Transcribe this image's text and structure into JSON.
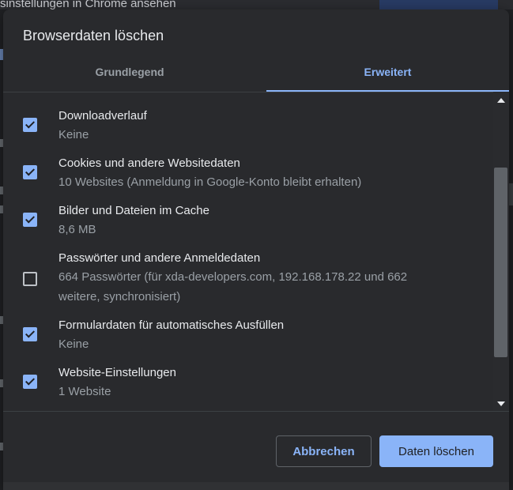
{
  "background": {
    "heading": "sinstellungen in Chrome ansehen"
  },
  "dialog": {
    "title": "Browserdaten löschen",
    "tabs": [
      {
        "label": "Grundlegend",
        "selected": false
      },
      {
        "label": "Erweitert",
        "selected": true
      }
    ],
    "items": [
      {
        "title": "Downloadverlauf",
        "description": "Keine",
        "checked": true
      },
      {
        "title": "Cookies und andere Websitedaten",
        "description": "10 Websites (Anmeldung in Google-Konto bleibt erhalten)",
        "checked": true
      },
      {
        "title": "Bilder und Dateien im Cache",
        "description": "8,6 MB",
        "checked": true
      },
      {
        "title": "Passwörter und andere Anmeldedaten",
        "description": "664 Passwörter (für xda-developers.com, 192.168.178.22 und 662 weitere, synchronisiert)",
        "checked": false
      },
      {
        "title": "Formulardaten für automatisches Ausfüllen",
        "description": "Keine",
        "checked": true
      },
      {
        "title": "Website-Einstellungen",
        "description": "1 Website",
        "checked": true
      }
    ],
    "buttons": {
      "cancel": "Abbrechen",
      "confirm": "Daten löschen"
    }
  },
  "colors": {
    "accent": "#8ab4f8",
    "dialog_bg": "#292a2d",
    "page_bg": "#202124"
  }
}
